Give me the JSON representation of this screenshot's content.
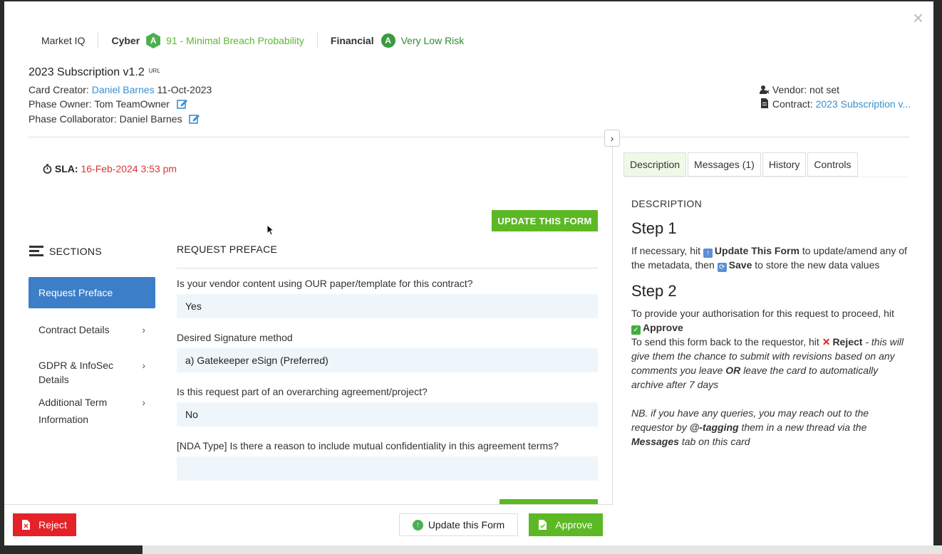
{
  "scores": {
    "market": "Market IQ",
    "cyber_label": "Cyber",
    "cyber_grade": "A",
    "cyber_text": "91 - Minimal Breach Probability",
    "financial_label": "Financial",
    "financial_grade": "A",
    "financial_text": "Very Low Risk"
  },
  "card": {
    "title": "2023 Subscription v1.2",
    "url_tag": "URL",
    "creator_label": "Card Creator:",
    "creator_name": "Daniel Barnes",
    "creator_date": "11-Oct-2023",
    "owner_label": "Phase Owner:",
    "owner_name": "Tom TeamOwner",
    "collab_label": "Phase Collaborator:",
    "collab_name": "Daniel Barnes",
    "vendor_label": "Vendor:",
    "vendor_value": "not set",
    "contract_label": "Contract:",
    "contract_value": "2023 Subscription v..."
  },
  "sla": {
    "label": "SLA:",
    "value": "16-Feb-2024 3:53 pm"
  },
  "buttons": {
    "update_top": "UPDATE THIS FORM",
    "reject": "Reject",
    "update_bottom": "Update this Form",
    "approve": "Approve"
  },
  "sections": {
    "title": "SECTIONS",
    "items": [
      {
        "label": "Request Preface"
      },
      {
        "label": "Contract Details"
      },
      {
        "label": "GDPR & InfoSec Details"
      },
      {
        "label": "Additional Term Information"
      }
    ]
  },
  "preface": {
    "title": "REQUEST PREFACE",
    "questions": [
      {
        "q": "Is your vendor content using OUR paper/template for this contract?",
        "a": "Yes"
      },
      {
        "q": "Desired Signature method",
        "a": "a) Gatekeeper eSign (Preferred)"
      },
      {
        "q": "Is this request part of an overarching agreement/project?",
        "a": "No"
      },
      {
        "q": "[NDA Type] Is there a reason to include mutual confidentiality in this agreement terms?",
        "a": ""
      }
    ]
  },
  "tabs": [
    "Description",
    "Messages (1)",
    "History",
    "Controls"
  ],
  "description": {
    "heading": "DESCRIPTION",
    "step1_title": "Step 1",
    "step1_a": "If necessary, hit",
    "step1_b": "Update This Form",
    "step1_c": "to update/amend any of the metadata, then",
    "step1_d": "Save",
    "step1_e": "to store the new data values",
    "step2_title": "Step 2",
    "step2_a": "To provide your authorisation for this request to proceed, hit",
    "step2_b": "Approve",
    "step2_c": "To send this form back to the requestor, hit",
    "step2_d": "Reject",
    "step2_e": "- this will give them the chance to submit with revisions based on any comments you leave",
    "step2_f": "OR",
    "step2_g": "leave the card to automatically archive after 7 days",
    "nb_a": "NB. if you have any queries, you may reach out to the requestor by",
    "nb_b": "@-tagging",
    "nb_c": "them in a new thread via the",
    "nb_d": "Messages",
    "nb_e": "tab on this card"
  }
}
